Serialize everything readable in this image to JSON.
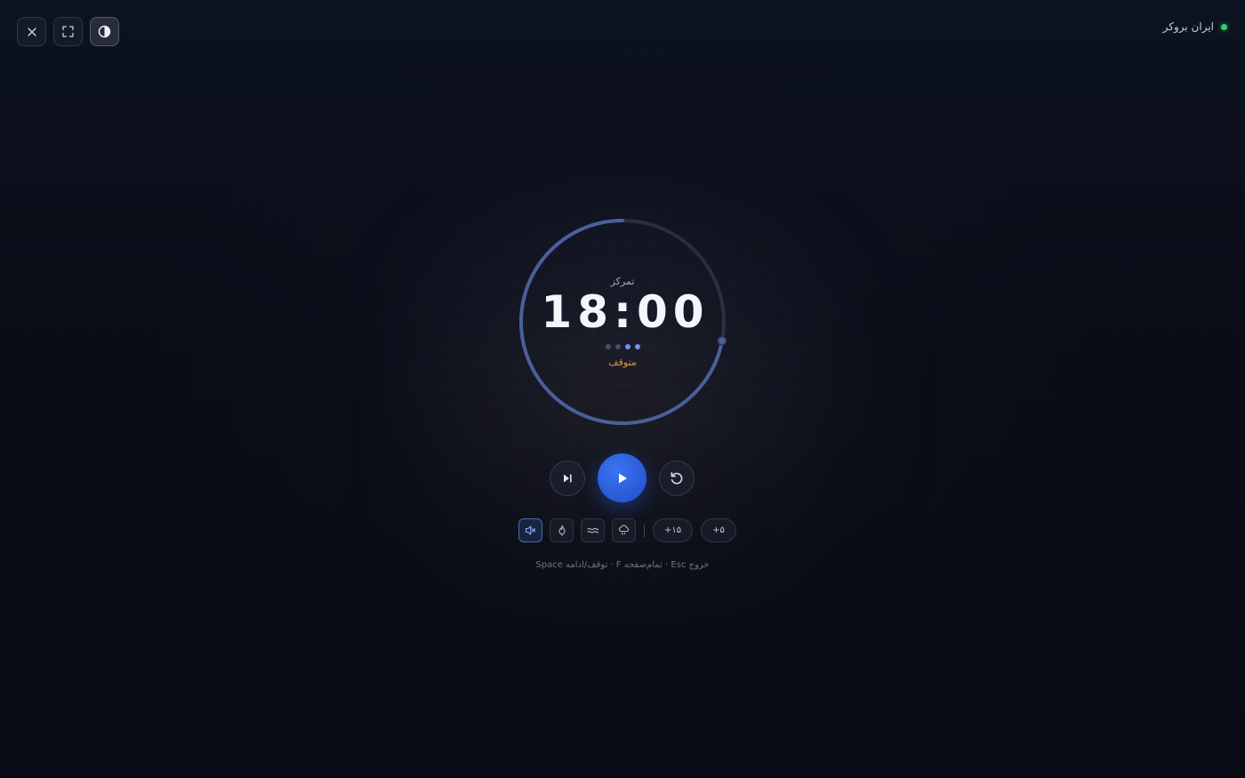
{
  "brand": {
    "name": "ایران بروکر",
    "status_color": "#2fd06a"
  },
  "window_controls": [
    {
      "icon": "close-icon",
      "label": "close"
    },
    {
      "icon": "fullscreen-icon",
      "label": "fullscreen"
    },
    {
      "icon": "contrast-icon",
      "label": "theme"
    }
  ],
  "timer": {
    "mode": "تمرکز",
    "time": "18:00",
    "status": "متوقف",
    "progress_fraction": 0.72,
    "sessions_total": 4,
    "sessions_done": 2,
    "accent_color": "#4a5f9c",
    "status_color": "#e0953a"
  },
  "playback": {
    "skip_icon": "skip-forward-icon",
    "play_icon": "play-icon",
    "reset_icon": "reset-icon",
    "play_color": "#2858d6"
  },
  "ambient": {
    "sounds": [
      {
        "icon": "mute-icon",
        "active": true
      },
      {
        "icon": "fire-icon",
        "active": false
      },
      {
        "icon": "waves-icon",
        "active": false
      },
      {
        "icon": "rain-icon",
        "active": false
      }
    ],
    "extend": [
      {
        "label": "+۱۵"
      },
      {
        "label": "+۵"
      }
    ]
  },
  "shortcuts": "Space توقف/ادامه · F تمام‌صفحه · Esc خروج"
}
